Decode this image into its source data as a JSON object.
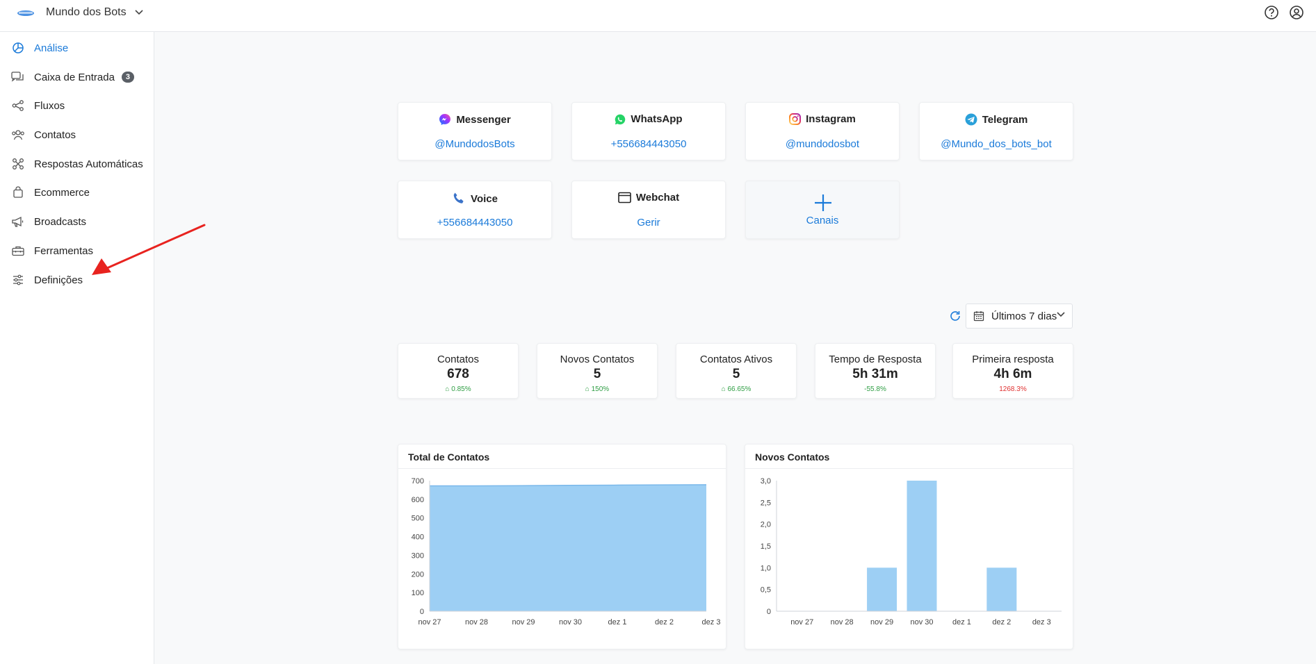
{
  "header": {
    "workspace_name": "Mundo dos Bots",
    "icons": [
      "logo",
      "chevron-down-icon",
      "help-icon",
      "account-icon"
    ]
  },
  "sidebar": {
    "items": [
      {
        "label": "Análise",
        "icon": "analytics-icon",
        "active": true
      },
      {
        "label": "Caixa de Entrada",
        "icon": "inbox-icon",
        "badge": "3"
      },
      {
        "label": "Fluxos",
        "icon": "flows-icon"
      },
      {
        "label": "Contatos",
        "icon": "contacts-icon"
      },
      {
        "label": "Respostas Automáticas",
        "icon": "auto-replies-icon"
      },
      {
        "label": "Ecommerce",
        "icon": "shopping-bag-icon"
      },
      {
        "label": "Broadcasts",
        "icon": "megaphone-icon"
      },
      {
        "label": "Ferramentas",
        "icon": "toolbox-icon"
      },
      {
        "label": "Definições",
        "icon": "settings-sliders-icon"
      }
    ]
  },
  "channels": [
    {
      "name": "Messenger",
      "link": "@MundodosBots",
      "icon": "messenger-icon"
    },
    {
      "name": "WhatsApp",
      "link": "+556684443050",
      "icon": "whatsapp-icon"
    },
    {
      "name": "Instagram",
      "link": "@mundodosbot",
      "icon": "instagram-icon"
    },
    {
      "name": "Telegram",
      "link": "@Mundo_dos_bots_bot",
      "icon": "telegram-icon"
    },
    {
      "name": "Voice",
      "link": "+556684443050",
      "icon": "phone-icon"
    },
    {
      "name": "Webchat",
      "link": "Gerir",
      "icon": "browser-window-icon"
    }
  ],
  "add_channel": {
    "label": "Canais",
    "icon": "plus-icon"
  },
  "date_filter": {
    "value": "Últimos 7 dias",
    "icons": [
      "refresh-icon",
      "calendar-icon",
      "chevron-down-icon"
    ]
  },
  "stats": [
    {
      "title": "Contatos",
      "value": "678",
      "delta": "0.85%",
      "trend": "up"
    },
    {
      "title": "Novos Contatos",
      "value": "5",
      "delta": "150%",
      "trend": "up"
    },
    {
      "title": "Contatos Ativos",
      "value": "5",
      "delta": "66.65%",
      "trend": "up"
    },
    {
      "title": "Tempo de Resposta",
      "value": "5h 31m",
      "delta": "-55.8%",
      "trend": "up"
    },
    {
      "title": "Primeira resposta",
      "value": "4h 6m",
      "delta": "1268.3%",
      "trend": "down"
    }
  ],
  "colors": {
    "accent": "#1a7ad9",
    "chart_fill": "#9dcff4",
    "chart_line": "#7ab8ea",
    "up": "#2f9e44",
    "down": "#e03131",
    "annotation_arrow": "#e8231f"
  },
  "chart_data": [
    {
      "type": "area",
      "title": "Total de Contatos",
      "categories": [
        "nov 27",
        "nov 28",
        "nov 29",
        "nov 30",
        "dez 1",
        "dez 2",
        "dez 3"
      ],
      "values": [
        672,
        672,
        673,
        675,
        676,
        677,
        678
      ],
      "yticks": [
        "0",
        "100",
        "200",
        "300",
        "400",
        "500",
        "600",
        "700"
      ],
      "ylim": [
        0,
        700
      ],
      "grid": false
    },
    {
      "type": "bar",
      "title": "Novos Contatos",
      "categories": [
        "nov 27",
        "nov 28",
        "nov 29",
        "nov 30",
        "dez 1",
        "dez 2",
        "dez 3"
      ],
      "values": [
        0,
        0,
        1,
        3,
        0,
        1,
        0
      ],
      "yticks": [
        "0",
        "0,5",
        "1,0",
        "1,5",
        "2,0",
        "2,5",
        "3,0"
      ],
      "ylim": [
        0,
        3
      ],
      "grid": false
    }
  ]
}
